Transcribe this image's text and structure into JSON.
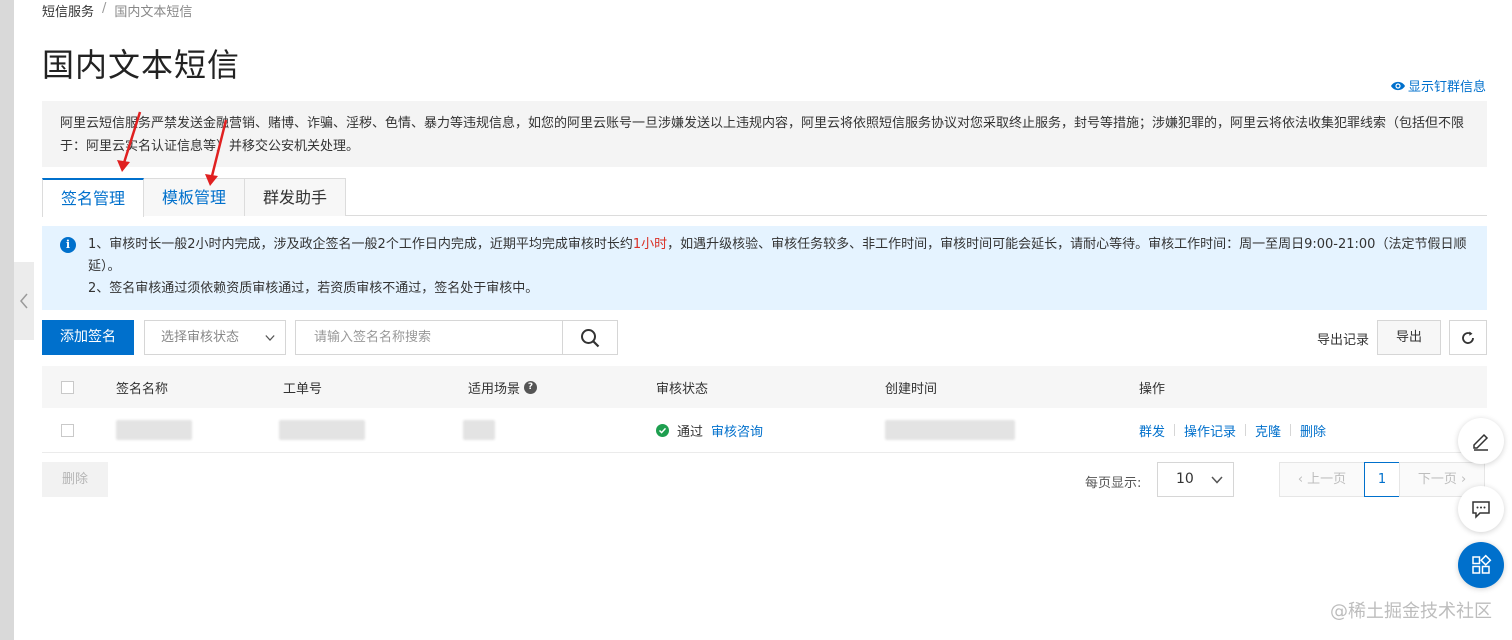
{
  "breadcrumb": {
    "parent": "短信服务",
    "separator": "/",
    "current": "国内文本短信"
  },
  "page_title": "国内文本短信",
  "top_link": "显示钉群信息",
  "warning_text": "阿里云短信服务严禁发送金融营销、赌博、诈骗、淫秽、色情、暴力等违规信息，如您的阿里云账号一旦涉嫌发送以上违规内容，阿里云将依照短信服务协议对您采取终止服务，封号等措施；涉嫌犯罪的，阿里云将依法收集犯罪线索（包括但不限于：阿里云实名认证信息等）并移交公安机关处理。",
  "tabs": [
    {
      "label": "签名管理",
      "active": true
    },
    {
      "label": "模板管理",
      "active": false
    },
    {
      "label": "群发助手",
      "active": false
    }
  ],
  "info": {
    "line1_pre": "1、审核时长一般2小时内完成，涉及政企签名一般2个工作日内完成，近期平均完成审核时长约",
    "line1_highlight": "1小时",
    "line1_post": "，如遇升级核验、审核任务较多、非工作时间，审核时间可能会延长，请耐心等待。审核工作时间：周一至周日9:00-21:00（法定节假日顺延）。",
    "line2": "2、签名审核通过须依赖资质审核通过，若资质审核不通过，签名处于审核中。"
  },
  "toolbar": {
    "add_label": "添加签名",
    "status_placeholder": "选择审核状态",
    "search_placeholder": "请输入签名名称搜索",
    "export_log_label": "导出记录",
    "export_label": "导出"
  },
  "table": {
    "headers": {
      "name": "签名名称",
      "ticket": "工单号",
      "scene": "适用场景",
      "status": "审核状态",
      "created": "创建时间",
      "ops": "操作"
    },
    "rows": [
      {
        "status": "通过",
        "status_link": "审核咨询",
        "ops": [
          "群发",
          "操作记录",
          "克隆",
          "删除"
        ]
      }
    ]
  },
  "footer": {
    "delete_label": "删除",
    "pagesize_label": "每页显示:",
    "pagesize_value": "10",
    "prev_label": "上一页",
    "current_page": "1",
    "next_label": "下一页"
  },
  "watermark": "@稀土掘金技术社区",
  "colors": {
    "primary": "#0070cc",
    "highlight_red": "#d93026",
    "success": "#1e9f4f",
    "info_bg": "#e5f3ff",
    "annotation_arrow": "#e02020"
  },
  "icons": [
    "eye-icon",
    "info-icon",
    "chevron-down-icon",
    "search-icon",
    "refresh-icon",
    "help-icon",
    "check-circle-icon",
    "edit-icon",
    "chat-icon",
    "apps-icon"
  ]
}
